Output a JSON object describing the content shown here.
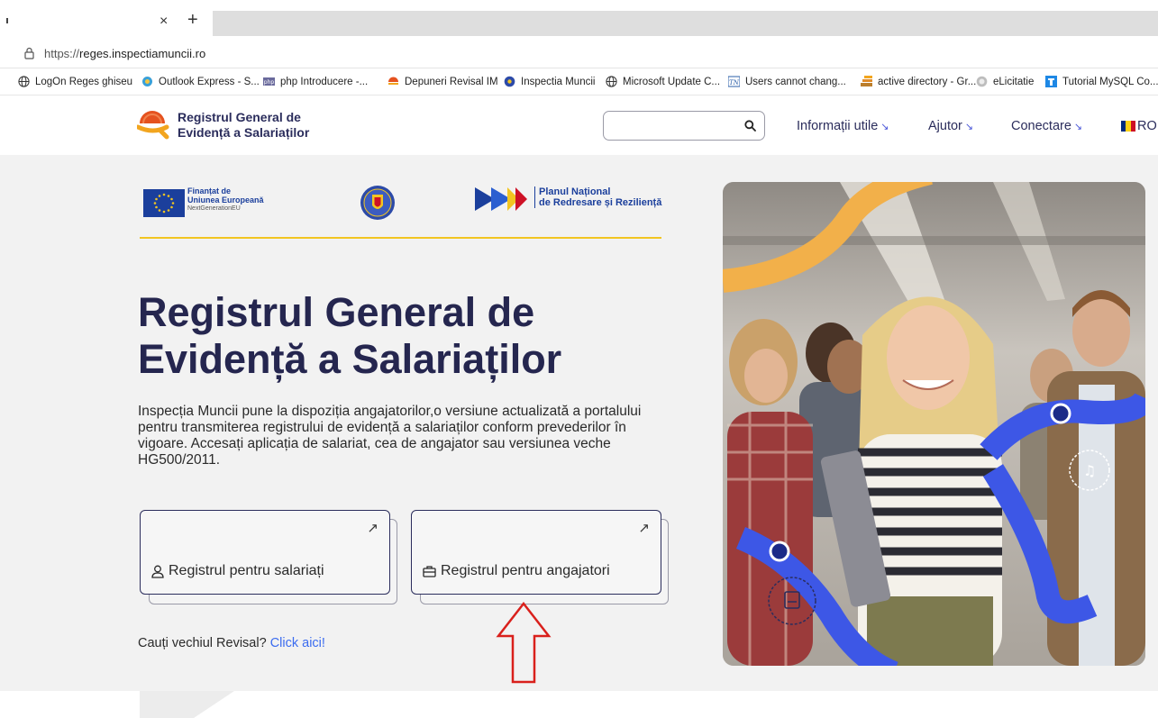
{
  "browser": {
    "tab_close": "×",
    "new_tab": "+",
    "url_protocol": "https://",
    "url_host": "reges.inspectiamuncii.ro"
  },
  "bookmarks": [
    {
      "label": "LogOn Reges ghiseu",
      "icon": "globe-icon"
    },
    {
      "label": "Outlook Express - S...",
      "icon": "outlook-icon"
    },
    {
      "label": "php Introducere -...",
      "icon": "php-icon"
    },
    {
      "label": "Depuneri Revisal IM",
      "icon": "reges-icon"
    },
    {
      "label": "Inspectia Muncii",
      "icon": "inspectia-icon"
    },
    {
      "label": "Microsoft Update C...",
      "icon": "globe-icon"
    },
    {
      "label": "Users cannot chang...",
      "icon": "tn-icon"
    },
    {
      "label": "active directory - Gr...",
      "icon": "stack-icon"
    },
    {
      "label": "eLicitatie",
      "icon": "elicitatie-icon"
    },
    {
      "label": "Tutorial MySQL Co...",
      "icon": "tutorial-icon"
    }
  ],
  "header": {
    "logo_line1": "Registrul General de",
    "logo_line2": "Evidență a Salariaților",
    "nav": [
      {
        "label": "Informații utile"
      },
      {
        "label": "Ajutor"
      },
      {
        "label": "Conectare"
      }
    ],
    "nav_chevron": "↘",
    "lang": "RO"
  },
  "funding": {
    "eu_line1": "Finanțat de",
    "eu_line2": "Uniunea Europeană",
    "eu_line3": "NextGenerationEU",
    "pnrr_line1": "Planul Național",
    "pnrr_line2": "de Redresare și Reziliență"
  },
  "hero": {
    "title_line1": "Registrul General de",
    "title_line2": "Evidență a Salariaților",
    "description": "Inspecția Muncii pune la dispoziția angajatorilor,o versiune actualizată a portalului pentru transmiterea registrului de evidență a salariaților conform prevederilor în vigoare. Accesați aplicația de salariat, cea de angajator sau versiunea veche HG500/2011.",
    "card_arrow": "↗",
    "cards": [
      {
        "label": "Registrul pentru salariați",
        "icon": "person-icon"
      },
      {
        "label": "Registrul pentru angajatori",
        "icon": "briefcase-icon"
      }
    ],
    "old_text": "Cauți vechiul Revisal?",
    "old_link": "Click aici!"
  },
  "colors": {
    "brand_navy": "#2b2d5c",
    "accent_blue": "#3b6cf0",
    "accent_yellow": "#f2c521",
    "annotation_red": "#d9201c"
  }
}
